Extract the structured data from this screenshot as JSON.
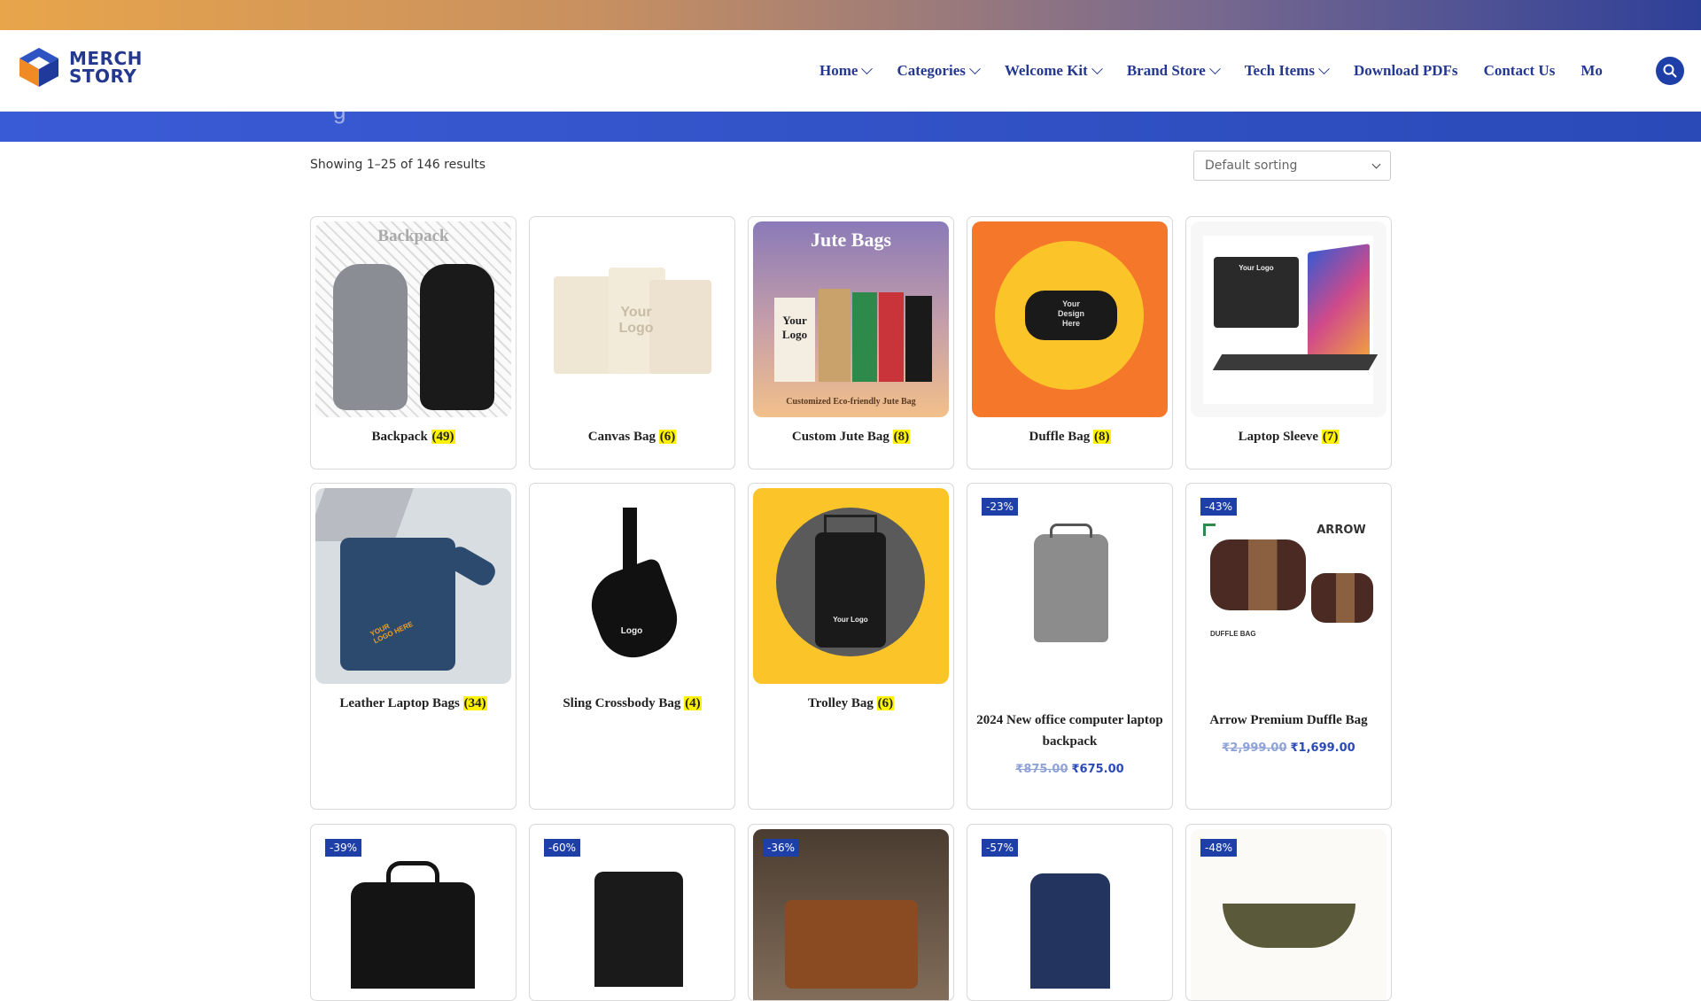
{
  "brand": {
    "line1": "MERCH",
    "line2": "STORY"
  },
  "nav": [
    {
      "label": "Home",
      "dropdown": true
    },
    {
      "label": "Categories",
      "dropdown": true
    },
    {
      "label": "Welcome Kit",
      "dropdown": true
    },
    {
      "label": "Brand Store",
      "dropdown": true
    },
    {
      "label": "Tech Items",
      "dropdown": true
    },
    {
      "label": "Download PDFs",
      "dropdown": false
    },
    {
      "label": "Contact Us",
      "dropdown": false
    },
    {
      "label": "Mo",
      "dropdown": false
    }
  ],
  "results_text": "Showing 1–25 of 146 results",
  "sort_label": "Default sorting",
  "categories": [
    {
      "name": "Backpack",
      "count": "(49)",
      "image_text": "Backpack"
    },
    {
      "name": "Canvas Bag",
      "count": "(6)",
      "image_text": "Your Logo"
    },
    {
      "name": "Custom Jute Bag",
      "count": "(8)",
      "image_text": "Jute Bags",
      "image_sub": "Customized Eco-friendly Jute Bag",
      "image_logo": "Your Logo"
    },
    {
      "name": "Duffle Bag",
      "count": "(8)",
      "image_text": "Your Design Here"
    },
    {
      "name": "Laptop Sleeve",
      "count": "(7)",
      "image_text": "Your Logo"
    },
    {
      "name": "Leather Laptop Bags",
      "count": "(34)",
      "image_text": "YOUR LOGO HERE"
    },
    {
      "name": "Sling Crossbody Bag",
      "count": "(4)",
      "image_text": "Logo"
    },
    {
      "name": "Trolley Bag",
      "count": "(6)",
      "image_text": "Your Logo"
    }
  ],
  "products": [
    {
      "badge": "-23%",
      "title": "2024 New office computer laptop backpack",
      "old_price": "₹875.00",
      "price": "₹675.00"
    },
    {
      "badge": "-43%",
      "title": "Arrow Premium Duffle Bag",
      "old_price": "₹2,999.00",
      "price": "₹1,699.00",
      "image_text": "ARROW",
      "image_sub": "DUFFLE BAG"
    }
  ],
  "row3_badges": [
    "-39%",
    "-60%",
    "-36%",
    "-57%",
    "-48%"
  ],
  "colors": {
    "accent": "#24388f",
    "badge": "#1e3fa8",
    "count_highlight": "#fff200"
  }
}
